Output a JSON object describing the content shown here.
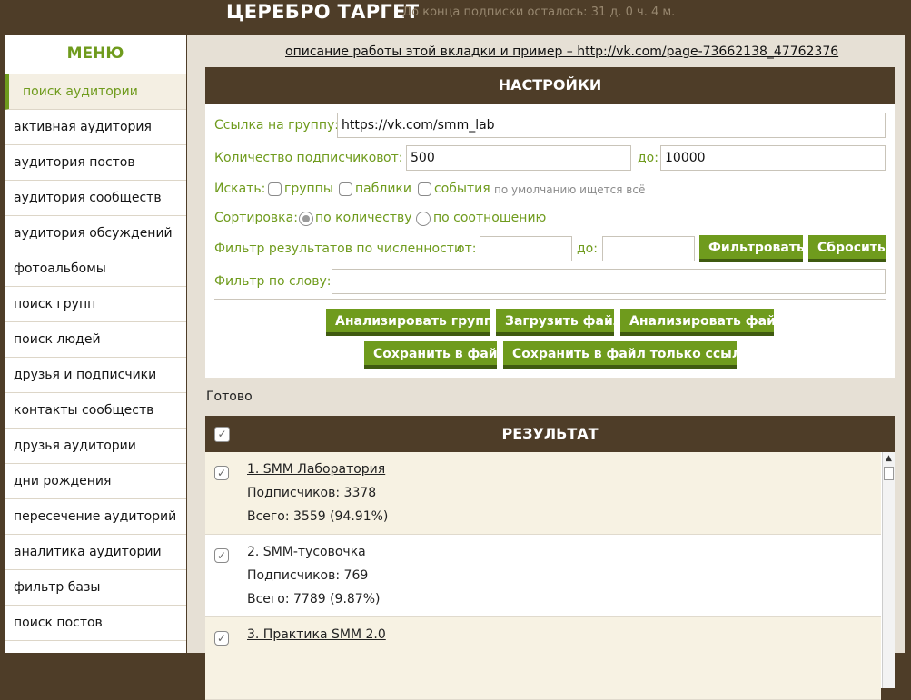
{
  "header": {
    "app_title": "ЦЕРЕБРО ТАРГЕТ",
    "subscription": "До конца подписки осталось: 31 д. 0 ч. 4 м."
  },
  "sidebar": {
    "title": "МЕНЮ",
    "items": [
      {
        "label": "поиск аудитории",
        "active": true
      },
      {
        "label": "активная аудитория"
      },
      {
        "label": "аудитория постов"
      },
      {
        "label": "аудитория сообществ"
      },
      {
        "label": "аудитория обсуждений"
      },
      {
        "label": "фотоальбомы"
      },
      {
        "label": "поиск групп"
      },
      {
        "label": "поиск людей"
      },
      {
        "label": "друзья и подписчики"
      },
      {
        "label": "контакты сообществ"
      },
      {
        "label": "друзья аудитории"
      },
      {
        "label": "дни рождения"
      },
      {
        "label": "пересечение аудиторий"
      },
      {
        "label": "аналитика аудитории"
      },
      {
        "label": "фильтр базы"
      },
      {
        "label": "поиск постов"
      }
    ]
  },
  "help_link": "описание работы этой вкладки и пример – http://vk.com/page-73662138_47762376",
  "settings": {
    "header": "НАСТРОЙКИ",
    "group_link_label": "Ссылка на группу:",
    "group_link_value": "https://vk.com/smm_lab",
    "subscribers_label": "Количество подписчиков",
    "from_label": "от:",
    "from_value": "500",
    "to_label": "до:",
    "to_value": "10000",
    "search_label": "Искать:",
    "search_options": [
      "группы",
      "паблики",
      "события"
    ],
    "search_hint": "по умолчанию ищется всё",
    "sort_label": "Сортировка:",
    "sort_options": [
      "по количеству",
      "по соотношению"
    ],
    "sort_selected": "по количеству",
    "filter_count_label": "Фильтр результатов по численности",
    "filter_from_label": "от:",
    "filter_from_value": "",
    "filter_to_label": "до:",
    "filter_to_value": "",
    "filter_button": "Фильтровать",
    "reset_button": "Сбросить",
    "word_filter_label": "Фильтр по слову:",
    "word_filter_value": "",
    "analyze_group_button": "Анализировать группу",
    "load_file_button": "Загрузить файл",
    "analyze_file_button": "Анализировать файл",
    "save_file_button": "Сохранить в файл",
    "save_links_button": "Сохранить в файл только ссылки"
  },
  "status": "Готово",
  "results": {
    "header": "РЕЗУЛЬТАТ",
    "items": [
      {
        "title": "1. SMM Лаборатория",
        "subscribers": "Подписчиков: 3378",
        "total": "Всего: 3559 (94.91%)"
      },
      {
        "title": "2. SMM-тусовочка",
        "subscribers": "Подписчиков: 769",
        "total": "Всего: 7789 (9.87%)"
      },
      {
        "title": "3. Практика SMM 2.0",
        "subscribers": "",
        "total": ""
      }
    ]
  },
  "icons": {
    "checkmark": "✓",
    "scroll_up": "▲"
  },
  "colors": {
    "brown": "#4e3d28",
    "green": "#6f9b1d",
    "beige": "#e6e0d5"
  }
}
